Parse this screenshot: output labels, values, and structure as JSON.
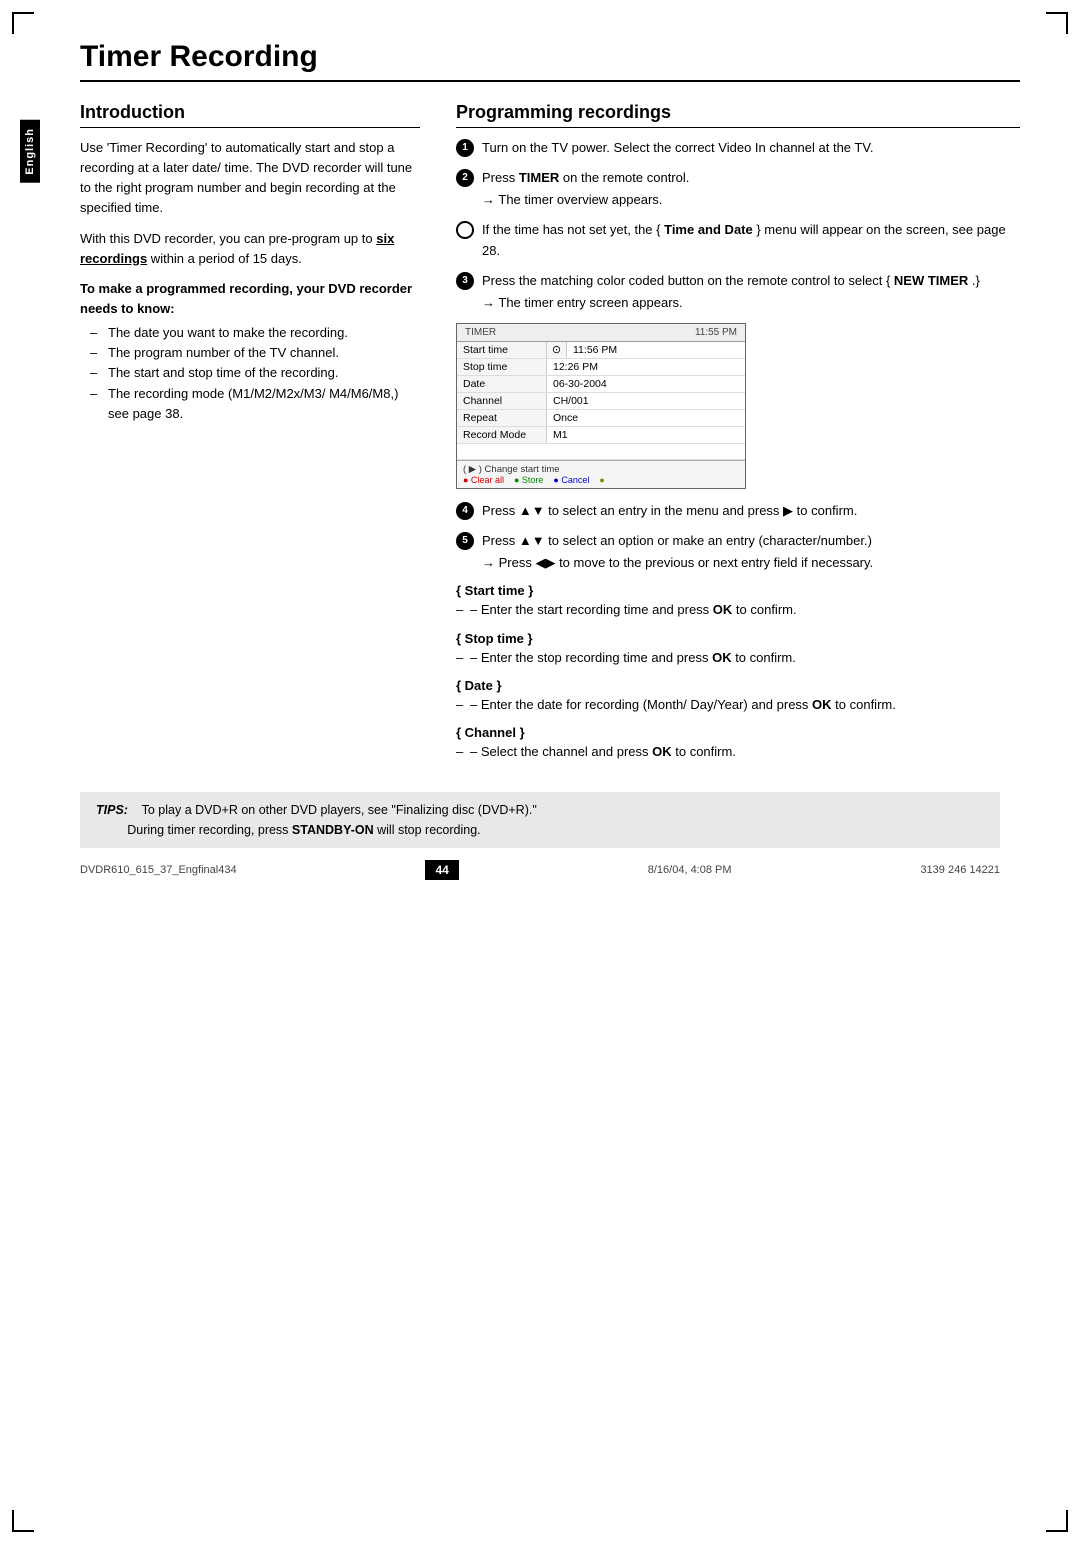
{
  "page": {
    "title": "Timer Recording",
    "sidebar_label": "English",
    "page_number": "44",
    "footer_left": "DVDR610_615_37_Engfinal434",
    "footer_center": "44",
    "footer_date": "8/16/04, 4:08 PM",
    "footer_right": "3139 246 14221"
  },
  "introduction": {
    "heading": "Introduction",
    "para1": "Use 'Timer Recording' to automatically start and stop a recording at a later date/ time. The DVD recorder will tune to the right program number and begin recording at the specified time.",
    "para2_prefix": "With this DVD recorder, you can pre-program up to ",
    "para2_bold_underline": "six recordings",
    "para2_suffix": " within a period of 15 days.",
    "bold_heading": "To make a programmed recording, your DVD recorder needs to know:",
    "bullets": [
      "The date you want to make the recording.",
      "The program number of the TV channel.",
      "The start and stop time of the recording.",
      "The recording mode (M1/M2/M2x/M3/ M4/M6/M8,) see page 38."
    ]
  },
  "programming": {
    "heading": "Programming recordings",
    "steps": [
      {
        "id": "1",
        "text": "Turn on the TV power. Select the correct Video In channel at the TV."
      },
      {
        "id": "2",
        "text_prefix": "Press ",
        "text_bold": "TIMER",
        "text_suffix": " on the remote control.",
        "arrow": "The timer overview appears."
      },
      {
        "id": "bullet",
        "text_prefix": "If the time has not set yet, the { ",
        "text_bold": "Time and Date",
        "text_suffix": " } menu will appear on the screen, see page 28."
      },
      {
        "id": "3",
        "text_prefix": "Press the matching color coded button on the remote control to select { ",
        "text_bold": "NEW TIMER",
        "text_suffix": " .}",
        "arrow": "The timer entry screen appears."
      },
      {
        "id": "4",
        "text_prefix": "Press ▲▼ to select an entry in the menu and press ▶ to confirm."
      },
      {
        "id": "5",
        "text_prefix": "Press ▲▼ to select an option or make an entry (character/number.)",
        "arrow": "Press ◀▶ to move to the previous or next entry field if necessary."
      }
    ],
    "timer_screen": {
      "header_left": "TIMER",
      "header_right": "11:55 PM",
      "rows": [
        {
          "label": "Start time",
          "value": "11:56 PM",
          "has_icon": true
        },
        {
          "label": "Stop time",
          "value": "12:26 PM",
          "has_icon": false
        },
        {
          "label": "Date",
          "value": "06-30-2004",
          "has_icon": false
        },
        {
          "label": "Channel",
          "value": "CH/001",
          "has_icon": false
        },
        {
          "label": "Repeat",
          "value": "Once",
          "has_icon": false
        },
        {
          "label": "Record Mode",
          "value": "M1",
          "has_icon": false
        }
      ],
      "footer_top": "( ▶ ) Change start time",
      "footer_buttons": [
        {
          "color": "red",
          "label": "● Clear all"
        },
        {
          "color": "green",
          "label": "● Store"
        },
        {
          "color": "blue",
          "label": "● Cancel"
        },
        {
          "color": "yellow",
          "label": "●"
        }
      ]
    },
    "start_time": {
      "heading": "{ Start time }",
      "text_prefix": "– Enter the start recording time and press ",
      "text_bold": "OK",
      "text_suffix": " to confirm."
    },
    "stop_time": {
      "heading": "{ Stop time }",
      "text_prefix": "– Enter the stop recording time and press ",
      "text_bold": "OK",
      "text_suffix": " to confirm."
    },
    "date_section": {
      "heading": "{ Date }",
      "text_prefix": "– Enter the date for recording (Month/ Day/Year) and press ",
      "text_bold": "OK",
      "text_suffix": " to confirm."
    },
    "channel_section": {
      "heading": "{ Channel }",
      "text_prefix": "– Select the channel and press ",
      "text_bold": "OK",
      "text_suffix": " to confirm."
    }
  },
  "tips": {
    "label": "TIPS:",
    "line1_prefix": "To play a DVD+R on other DVD players, see \"Finalizing disc (DVD+R).\"",
    "line2_prefix": "During timer recording, press ",
    "line2_bold": "STANDBY-ON",
    "line2_suffix": " will stop recording."
  }
}
